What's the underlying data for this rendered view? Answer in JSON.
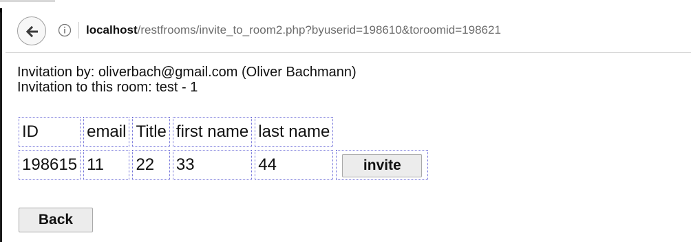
{
  "browser": {
    "url_host": "localhost",
    "url_path": "/restfrooms/invite_to_room2.php?byuserid=198610&toroomid=198621"
  },
  "page": {
    "invitation_by": "Invitation by: oliverbach@gmail.com (Oliver Bachmann)",
    "invitation_room": "Invitation to this room: test - 1"
  },
  "table": {
    "headers": [
      "ID",
      "email",
      "Title",
      "first name",
      "last name"
    ],
    "rows": [
      {
        "id": "198615",
        "email": "11",
        "title": "22",
        "first_name": "33",
        "last_name": "44",
        "action": "invite"
      }
    ]
  },
  "buttons": {
    "back": "Back"
  }
}
